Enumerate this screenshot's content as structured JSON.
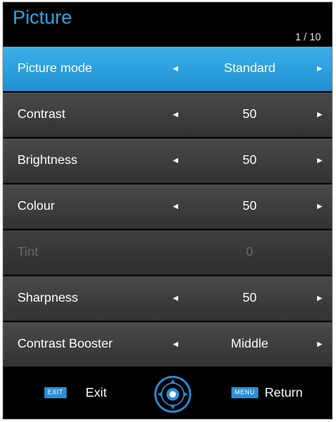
{
  "header": {
    "title": "Picture",
    "page_indicator": "1 / 10"
  },
  "menu": {
    "arrow_left": "◄",
    "arrow_right": "►",
    "items": [
      {
        "label": "Picture mode",
        "value": "Standard",
        "state": "selected"
      },
      {
        "label": "Contrast",
        "value": "50",
        "state": "normal"
      },
      {
        "label": "Brightness",
        "value": "50",
        "state": "normal"
      },
      {
        "label": "Colour",
        "value": "50",
        "state": "normal"
      },
      {
        "label": "Tint",
        "value": "0",
        "state": "disabled"
      },
      {
        "label": "Sharpness",
        "value": "50",
        "state": "normal"
      },
      {
        "label": "Contrast Booster",
        "value": "Middle",
        "state": "normal"
      }
    ]
  },
  "footer": {
    "exit_key": "EXIT",
    "exit_label": "Exit",
    "return_key": "MENU",
    "return_label": "Return",
    "nav_icon": "navigation-pad-icon"
  },
  "colors": {
    "title": "#2aa6e3",
    "selected_row": "#2a9fdd",
    "row": "#3c3c3c",
    "disabled_text": "#6a6a6a",
    "key_badge": "#2a8fd8"
  }
}
